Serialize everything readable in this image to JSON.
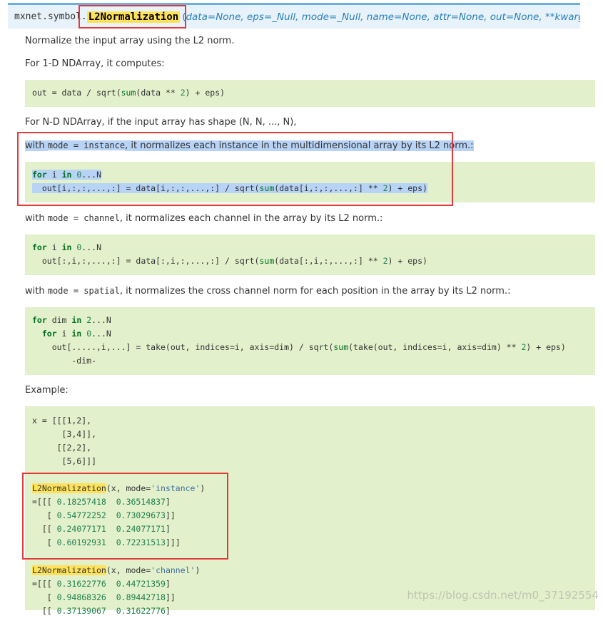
{
  "signature": {
    "prefix": "mxnet.symbol.",
    "name": "L2Normalization",
    "open_paren": "(",
    "params": "data=None, eps=_Null, mode=_Null, name=None, attr=None, out=None, **kwargs",
    "close_paren": ")"
  },
  "intro": "Normalize the input array using the L2 norm.",
  "one_d": {
    "text": "For 1-D NDArray, it computes:",
    "code": {
      "a": "out = data / sqrt(",
      "fn": "sum",
      "b": "(data ** ",
      "n": "2",
      "c": ") + eps)"
    }
  },
  "n_d_text": "For N-D NDArray, if the input array has shape (N, N, ..., N),",
  "instance": {
    "pre": "with ",
    "code": "mode = instance",
    "post": ", it normalizes each instance in the multidimensional array by its L2 norm.:",
    "line1": {
      "kw": "for",
      "var": " i ",
      "kw2": "in",
      "sp": " ",
      "n0": "0",
      "rest": "...N"
    },
    "line2": {
      "a": "  out[i,:,:,...,:] = data[i,:,:,...,:] / sqrt(",
      "fn": "sum",
      "b": "(data[i,:,:,...,:] ** ",
      "n": "2",
      "c": ") + eps)"
    }
  },
  "channel": {
    "pre": "with ",
    "code": "mode = channel",
    "post": ", it normalizes each channel in the array by its L2 norm.:",
    "line1": {
      "kw": "for",
      "var": " i ",
      "kw2": "in",
      "sp": " ",
      "n0": "0",
      "rest": "...N"
    },
    "line2": {
      "a": "  out[:,i,:,...,:] = data[:,i,:,...,:] / sqrt(",
      "fn": "sum",
      "b": "(data[:,i,:,...,:] ** ",
      "n": "2",
      "c": ") + eps)"
    }
  },
  "spatial": {
    "pre": "with ",
    "code": "mode = spatial",
    "post": ", it normalizes the cross channel norm for each position in the array by its L2 norm.:",
    "line1": {
      "kw": "for",
      "var": " dim ",
      "kw2": "in",
      "sp": " ",
      "n0": "2",
      "rest": "...N"
    },
    "line2": {
      "kw": "  for",
      "var": " i ",
      "kw2": "in",
      "sp": " ",
      "n0": "0",
      "rest": "...N"
    },
    "line3": {
      "a": "    out[.....,i,...] = take(out, indices=i, axis=dim) / sqrt(",
      "fn": "sum",
      "b": "(take(out, indices=i, axis=dim) ** ",
      "n": "2",
      "c": ") + eps)"
    },
    "line4": "        -dim-"
  },
  "example_label": "Example:",
  "example": {
    "x_lines": [
      "x = [[[1,2],",
      "      [3,4]],",
      "     [[2,2],",
      "      [5,6]]]"
    ],
    "inst_call": {
      "fn": "L2Normalization",
      "a": "(x, mode=",
      "s": "'instance'",
      "b": ")"
    },
    "inst_out": [
      {
        "p": "=[[[ ",
        "v1": "0.18257418",
        "m": "  ",
        "v2": "0.36514837",
        "e": "]"
      },
      {
        "p": "   [ ",
        "v1": "0.54772252",
        "m": "  ",
        "v2": "0.73029673",
        "e": "]]"
      },
      {
        "p": "  [[ ",
        "v1": "0.24077171",
        "m": "  ",
        "v2": "0.24077171",
        "e": "]"
      },
      {
        "p": "   [ ",
        "v1": "0.60192931",
        "m": "  ",
        "v2": "0.72231513",
        "e": "]]]"
      }
    ],
    "chan_call": {
      "fn": "L2Normalization",
      "a": "(x, mode=",
      "s": "'channel'",
      "b": ")"
    },
    "chan_out": [
      {
        "p": "=[[[ ",
        "v1": "0.31622776",
        "m": "  ",
        "v2": "0.44721359",
        "e": "]"
      },
      {
        "p": "   [ ",
        "v1": "0.94868326",
        "m": "  ",
        "v2": "0.89442718",
        "e": "]]"
      },
      {
        "p": "  [[ ",
        "v1": "0.37139067",
        "m": "  ",
        "v2": "0.31622776",
        "e": "]"
      }
    ]
  },
  "watermark": "https://blog.csdn.net/m0_37192554",
  "colors": {
    "code_bg": "#e2f0cb",
    "sig_bg": "#e7f2fa",
    "highlight": "#ffe25a",
    "annotation_box": "#e23b3b",
    "selection": "#b7d3f5"
  }
}
